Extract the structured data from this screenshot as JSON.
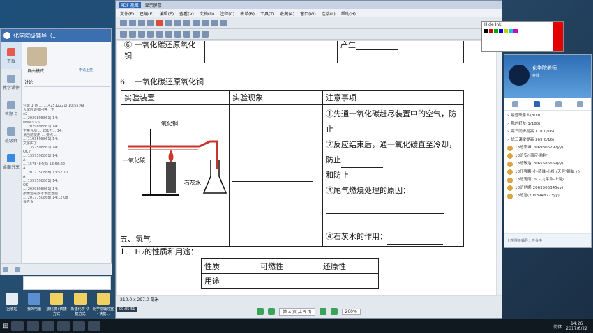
{
  "chat": {
    "title": "化学院级辅导（...",
    "nav": [
      "下载",
      "教学课件",
      "答题卡",
      "班级群",
      "桌面分享"
    ],
    "mode": "自由模式",
    "mode_right": "申请上麦",
    "discussion_label": "讨论",
    "messages": [
      "讨论 1 条 ...(1142512221) 10:55:49",
      "大家应该要回答一下",
      "e2",
      "...(2029898861) 14:",
      "www~~~",
      "...(2029898861) 14:",
      "下带合测 ... 2017/... 14:",
      "请当前使用 ... 要点 ...",
      "...(1193598861) 14:",
      "文字由了",
      "...(1357598861) 14:",
      "OK了",
      "...(1357598861) 14:",
      "A",
      "...(1578484(6) 13:56:22",
      "A",
      "...(2017750868) 13:57:17",
      "A",
      "...(1357598861) 14:",
      "OK",
      "...(2029898861) 14:",
      "按暖还是放冰水放置后",
      "...(2017750868) 14:12:08",
      "会告诉"
    ]
  },
  "pdf": {
    "title": "PDF 视图",
    "title2": "显示屏幕",
    "menu": [
      "文件(F)",
      "已编(E)",
      "编辑(E)",
      "查看(V)",
      "文档(D)",
      "注释(C)",
      "表单(R)",
      "工具(T)",
      "收藏(A)",
      "窗口(W)",
      "连接(L)",
      "帮助(H)"
    ],
    "doc": {
      "row6_label": "⑥ 一氧化碳还原氧化铜",
      "row6_blank_prefix": "产生",
      "section6": "6.   一氧化碳还原氧化铜",
      "headers": [
        "实验装置",
        "实验现象",
        "注意事项"
      ],
      "apparatus": {
        "label_cuo": "氧化铜",
        "label_co": "一氧化碳",
        "label_lime": "石灰水"
      },
      "notes": [
        "①先通一氧化碳赶尽装置中的空气，防止",
        "②反应结束后，通一氧化碳直至冷却，防止",
        "和防止",
        "③尾气燃烧处理的原因：",
        "④石灰水的作用："
      ],
      "section5": "五、氢气",
      "h2_item": "1.   H₂的性质和用途：",
      "h2_table": {
        "row1": [
          "性质",
          "可燃性",
          "还原性"
        ],
        "row2": [
          "用途",
          "",
          ""
        ]
      }
    },
    "status": "210.0 x 297.0 毫米",
    "page_indicator": "第 4 页 共 5 页",
    "zoom": "260%"
  },
  "ink": {
    "hide": "Hide Ink"
  },
  "qq": {
    "name": "化学院老师",
    "status": "在线",
    "groups": [
      "最近联系人(8/30)",
      "我的好友(1/180)",
      "高三同步提高 378(0/16)",
      "优三课堂提高 369(0/16)",
      "18班宏坤(2069306297yy)",
      "18班安(-南应-粒粒)",
      "18班敬浩(2065586659yy)",
      "18旺强鹏(小-精准-小杜 (天涯)钢脑 ) )",
      "18班宠雨(2K - 九平命-上海)",
      "18班他娜(2063505345yy)",
      "18班浩(2063948273yy)"
    ],
    "footer": "化学院级辅导：在会中"
  },
  "desktop_icons": [
    "回收站",
    "我的电脑",
    "放化双+快捷方式",
    "新建化学-快捷方式",
    "化学院辅导室 - 快捷..."
  ],
  "taskbar": {
    "time": "14:26",
    "date": "2017/6/22",
    "lang": "简体",
    "clock_left": "00:05:51"
  }
}
